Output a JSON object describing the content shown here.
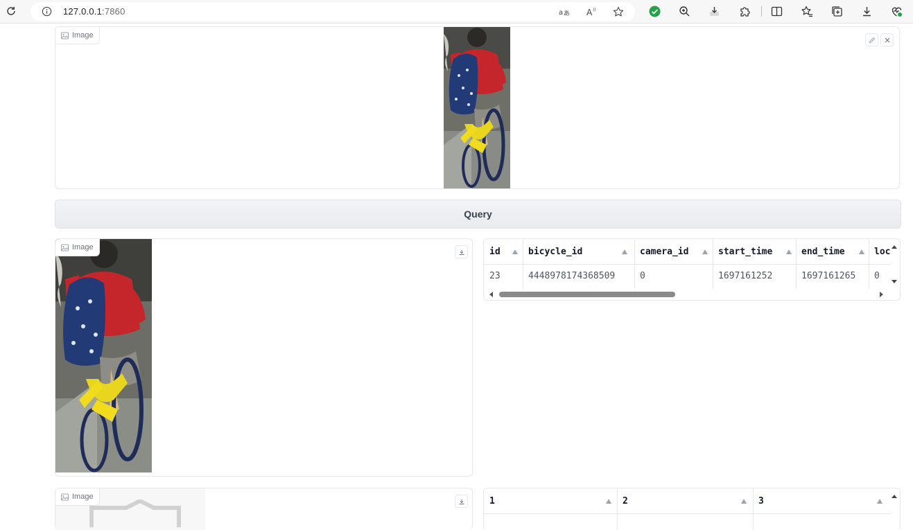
{
  "browser": {
    "url_host": "127.0.0.1",
    "url_port": ":7860"
  },
  "input_image": {
    "label": "Image"
  },
  "query_button": {
    "label": "Query"
  },
  "result_image": {
    "label": "Image"
  },
  "results_table": {
    "columns": [
      "id",
      "bicycle_id",
      "camera_id",
      "start_time",
      "end_time",
      "loc"
    ],
    "rows": [
      [
        "23",
        "4448978174368509",
        "0",
        "1697161252",
        "1697161265",
        "0"
      ]
    ]
  },
  "second_image": {
    "label": "Image"
  },
  "second_table": {
    "columns": [
      "1",
      "2",
      "3"
    ]
  },
  "colors": {
    "accent_green": "#22a34a",
    "border": "#e5e7eb"
  }
}
